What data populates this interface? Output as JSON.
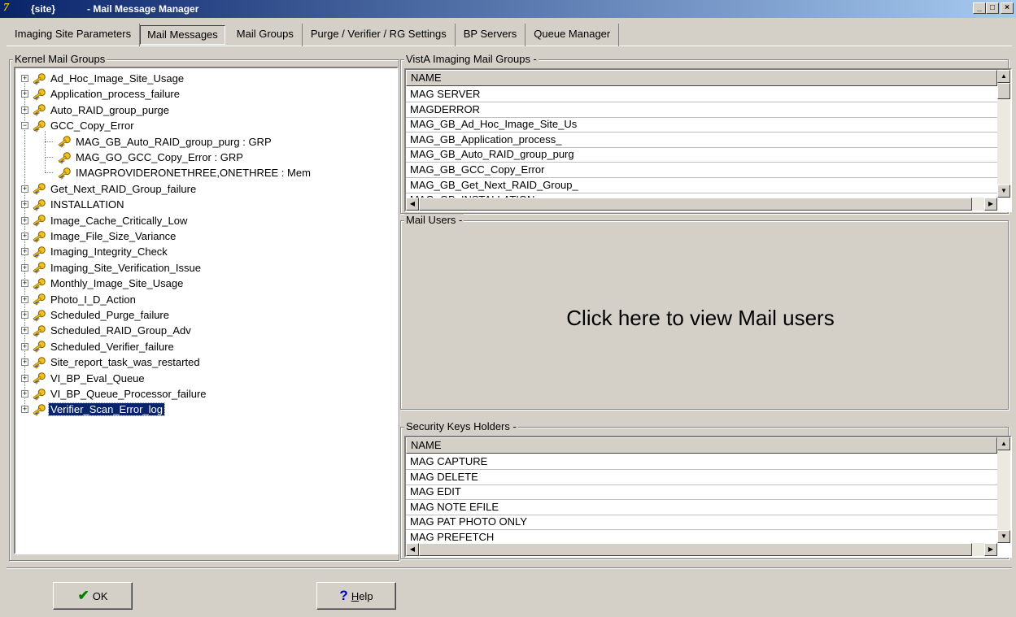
{
  "window": {
    "site": "{site}",
    "title": "- Mail Message Manager",
    "app_icon_text": "7",
    "minimize": "_",
    "maximize": "□",
    "close": "×"
  },
  "tabs": [
    {
      "label": "Imaging Site Parameters",
      "active": false
    },
    {
      "label": "Mail Messages",
      "active": true
    },
    {
      "label": "Mail Groups",
      "active": false
    },
    {
      "label": "Purge / Verifier / RG Settings",
      "active": false
    },
    {
      "label": "BP Servers",
      "active": false
    },
    {
      "label": "Queue Manager",
      "active": false
    }
  ],
  "kernel": {
    "label": "Kernel Mail Groups",
    "items": [
      {
        "label": "Ad_Hoc_Image_Site_Usage",
        "expander": "+",
        "level": 0
      },
      {
        "label": "Application_process_failure",
        "expander": "+",
        "level": 0
      },
      {
        "label": "Auto_RAID_group_purge",
        "expander": "+",
        "level": 0
      },
      {
        "label": "GCC_Copy_Error",
        "expander": "−",
        "level": 0
      },
      {
        "label": "MAG_GB_Auto_RAID_group_purg : GRP",
        "expander": "",
        "level": 1
      },
      {
        "label": "MAG_GO_GCC_Copy_Error : GRP",
        "expander": "",
        "level": 1
      },
      {
        "label": "IMAGPROVIDERONETHREE,ONETHREE : Mem",
        "expander": "",
        "level": 1
      },
      {
        "label": "Get_Next_RAID_Group_failure",
        "expander": "+",
        "level": 0
      },
      {
        "label": "INSTALLATION",
        "expander": "+",
        "level": 0
      },
      {
        "label": "Image_Cache_Critically_Low",
        "expander": "+",
        "level": 0
      },
      {
        "label": "Image_File_Size_Variance",
        "expander": "+",
        "level": 0
      },
      {
        "label": "Imaging_Integrity_Check",
        "expander": "+",
        "level": 0
      },
      {
        "label": "Imaging_Site_Verification_Issue",
        "expander": "+",
        "level": 0
      },
      {
        "label": "Monthly_Image_Site_Usage",
        "expander": "+",
        "level": 0
      },
      {
        "label": "Photo_I_D_Action",
        "expander": "+",
        "level": 0
      },
      {
        "label": "Scheduled_Purge_failure",
        "expander": "+",
        "level": 0
      },
      {
        "label": "Scheduled_RAID_Group_Adv",
        "expander": "+",
        "level": 0
      },
      {
        "label": "Scheduled_Verifier_failure",
        "expander": "+",
        "level": 0
      },
      {
        "label": "Site_report_task_was_restarted",
        "expander": "+",
        "level": 0
      },
      {
        "label": "VI_BP_Eval_Queue",
        "expander": "+",
        "level": 0
      },
      {
        "label": "VI_BP_Queue_Processor_failure",
        "expander": "+",
        "level": 0
      },
      {
        "label": "Verifier_Scan_Error_log",
        "expander": "+",
        "level": 0,
        "selected": true
      }
    ]
  },
  "vista_groups": {
    "label": "VistA Imaging Mail Groups -",
    "header": "NAME",
    "rows": [
      "MAG SERVER",
      "MAGDERROR",
      "MAG_GB_Ad_Hoc_Image_Site_Us",
      "MAG_GB_Application_process_",
      "MAG_GB_Auto_RAID_group_purg",
      "MAG_GB_GCC_Copy_Error",
      "MAG_GB_Get_Next_RAID_Group_",
      "MAG_GB_INSTALLATION"
    ]
  },
  "mail_users": {
    "label": "Mail Users -",
    "prompt": "Click here to view Mail users"
  },
  "security_keys": {
    "label": "Security Keys Holders -",
    "header": "NAME",
    "rows": [
      "MAG CAPTURE",
      "MAG DELETE",
      "MAG EDIT",
      "MAG NOTE EFILE",
      "MAG PAT PHOTO ONLY",
      "MAG PREFETCH"
    ]
  },
  "buttons": {
    "ok": "OK",
    "help_underline": "H",
    "help_rest": "elp",
    "ok_icon": "✔",
    "help_icon": "?"
  },
  "colors": {
    "selection": "#0a246a",
    "check": "#008000",
    "help": "#0000c0"
  }
}
